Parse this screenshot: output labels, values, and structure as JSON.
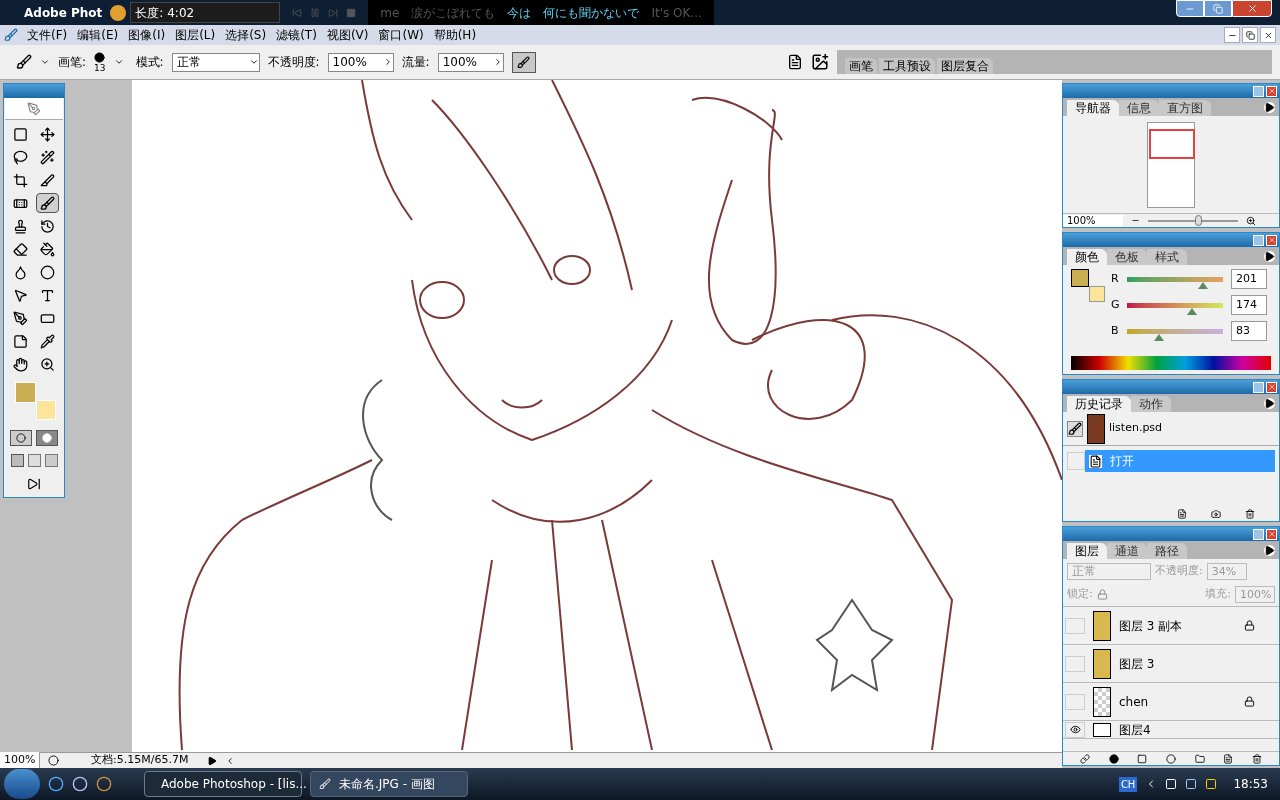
{
  "title_bar": {
    "app_title": "Adobe Phot",
    "player_length": "长度: 4:02",
    "lyrics": [
      {
        "text": "me",
        "highlighted": false
      },
      {
        "text": "涙がこぼれても",
        "highlighted": false
      },
      {
        "text": "今は",
        "highlighted": true
      },
      {
        "text": "何にも聞かないで",
        "highlighted": true
      },
      {
        "text": "It's OK...",
        "highlighted": false
      }
    ]
  },
  "menu": [
    "文件(F)",
    "编辑(E)",
    "图像(I)",
    "图层(L)",
    "选择(S)",
    "滤镜(T)",
    "视图(V)",
    "窗口(W)",
    "帮助(H)"
  ],
  "options_bar": {
    "brush_label": "画笔:",
    "brush_size": "13",
    "mode_label": "模式:",
    "mode": "正常",
    "opacity_label": "不透明度:",
    "opacity": "100%",
    "flow_label": "流量:",
    "flow": "100%",
    "airbrush_on": true,
    "palette_tabs": [
      "画笔",
      "工具预设",
      "图层复合"
    ]
  },
  "toolbox": {
    "tools": [
      {
        "kind": "marquee",
        "selected": false
      },
      {
        "kind": "move",
        "selected": false
      },
      {
        "kind": "lasso",
        "selected": false
      },
      {
        "kind": "wand",
        "selected": false
      },
      {
        "kind": "crop",
        "selected": false
      },
      {
        "kind": "slice",
        "selected": false
      },
      {
        "kind": "heal",
        "selected": false
      },
      {
        "kind": "brush",
        "selected": true
      },
      {
        "kind": "stamp",
        "selected": false
      },
      {
        "kind": "history",
        "selected": false
      },
      {
        "kind": "eraser",
        "selected": false
      },
      {
        "kind": "bucket",
        "selected": false
      },
      {
        "kind": "blur",
        "selected": false
      },
      {
        "kind": "dodge",
        "selected": false
      },
      {
        "kind": "select",
        "selected": false
      },
      {
        "kind": "type",
        "selected": false
      },
      {
        "kind": "pen",
        "selected": false
      },
      {
        "kind": "shape",
        "selected": false
      },
      {
        "kind": "notes",
        "selected": false
      },
      {
        "kind": "eyedropper",
        "selected": false
      },
      {
        "kind": "hand",
        "selected": false
      },
      {
        "kind": "zoom",
        "selected": false
      }
    ]
  },
  "navigator": {
    "tabs": [
      {
        "label": "导航器",
        "selected": true
      },
      {
        "label": "信息",
        "selected": false
      },
      {
        "label": "直方图",
        "selected": false
      }
    ],
    "zoom": "100%",
    "zoom_slider": {
      "level": 0.55
    }
  },
  "color": {
    "tabs": [
      {
        "label": "颜色",
        "selected": true
      },
      {
        "label": "色板",
        "selected": false
      },
      {
        "label": "样式",
        "selected": false
      }
    ],
    "channels": [
      {
        "name": "R",
        "value": "201",
        "level": 0.79
      },
      {
        "name": "G",
        "value": "174",
        "level": 0.68
      },
      {
        "name": "B",
        "value": "83",
        "level": 0.33
      }
    ]
  },
  "history": {
    "tabs": [
      {
        "label": "历史记录",
        "selected": true
      },
      {
        "label": "动作",
        "selected": false
      }
    ],
    "snapshot": "listen.psd",
    "states": [
      {
        "label": "打开",
        "selected": true
      }
    ]
  },
  "layers": {
    "tabs": [
      {
        "label": "图层",
        "selected": true
      },
      {
        "label": "通道",
        "selected": false
      },
      {
        "label": "路径",
        "selected": false
      }
    ],
    "blend_mode": "正常",
    "opacity_label": "不透明度:",
    "opacity": "34%",
    "lock_label": "锁定:",
    "fill_label": "填充:",
    "fill": "100%",
    "items": [
      {
        "name": "图层 3 副本",
        "visible": false,
        "locked": true,
        "kind": "figure"
      },
      {
        "name": "图层 3",
        "visible": false,
        "locked": false,
        "kind": "figure"
      },
      {
        "name": "chen",
        "visible": false,
        "locked": true,
        "kind": "empty"
      },
      {
        "name": "图层4",
        "visible": true,
        "locked": false,
        "kind": "white"
      }
    ]
  },
  "status_bar": {
    "zoom": "100%",
    "document": "文档:5.15M/65.7M"
  },
  "taskbar": {
    "tasks": [
      {
        "label": "Adobe Photoshop - [lis...",
        "selected": true
      },
      {
        "label": "未命名.JPG - 画图",
        "selected": false
      }
    ],
    "language": "CH",
    "clock": "18:53"
  }
}
